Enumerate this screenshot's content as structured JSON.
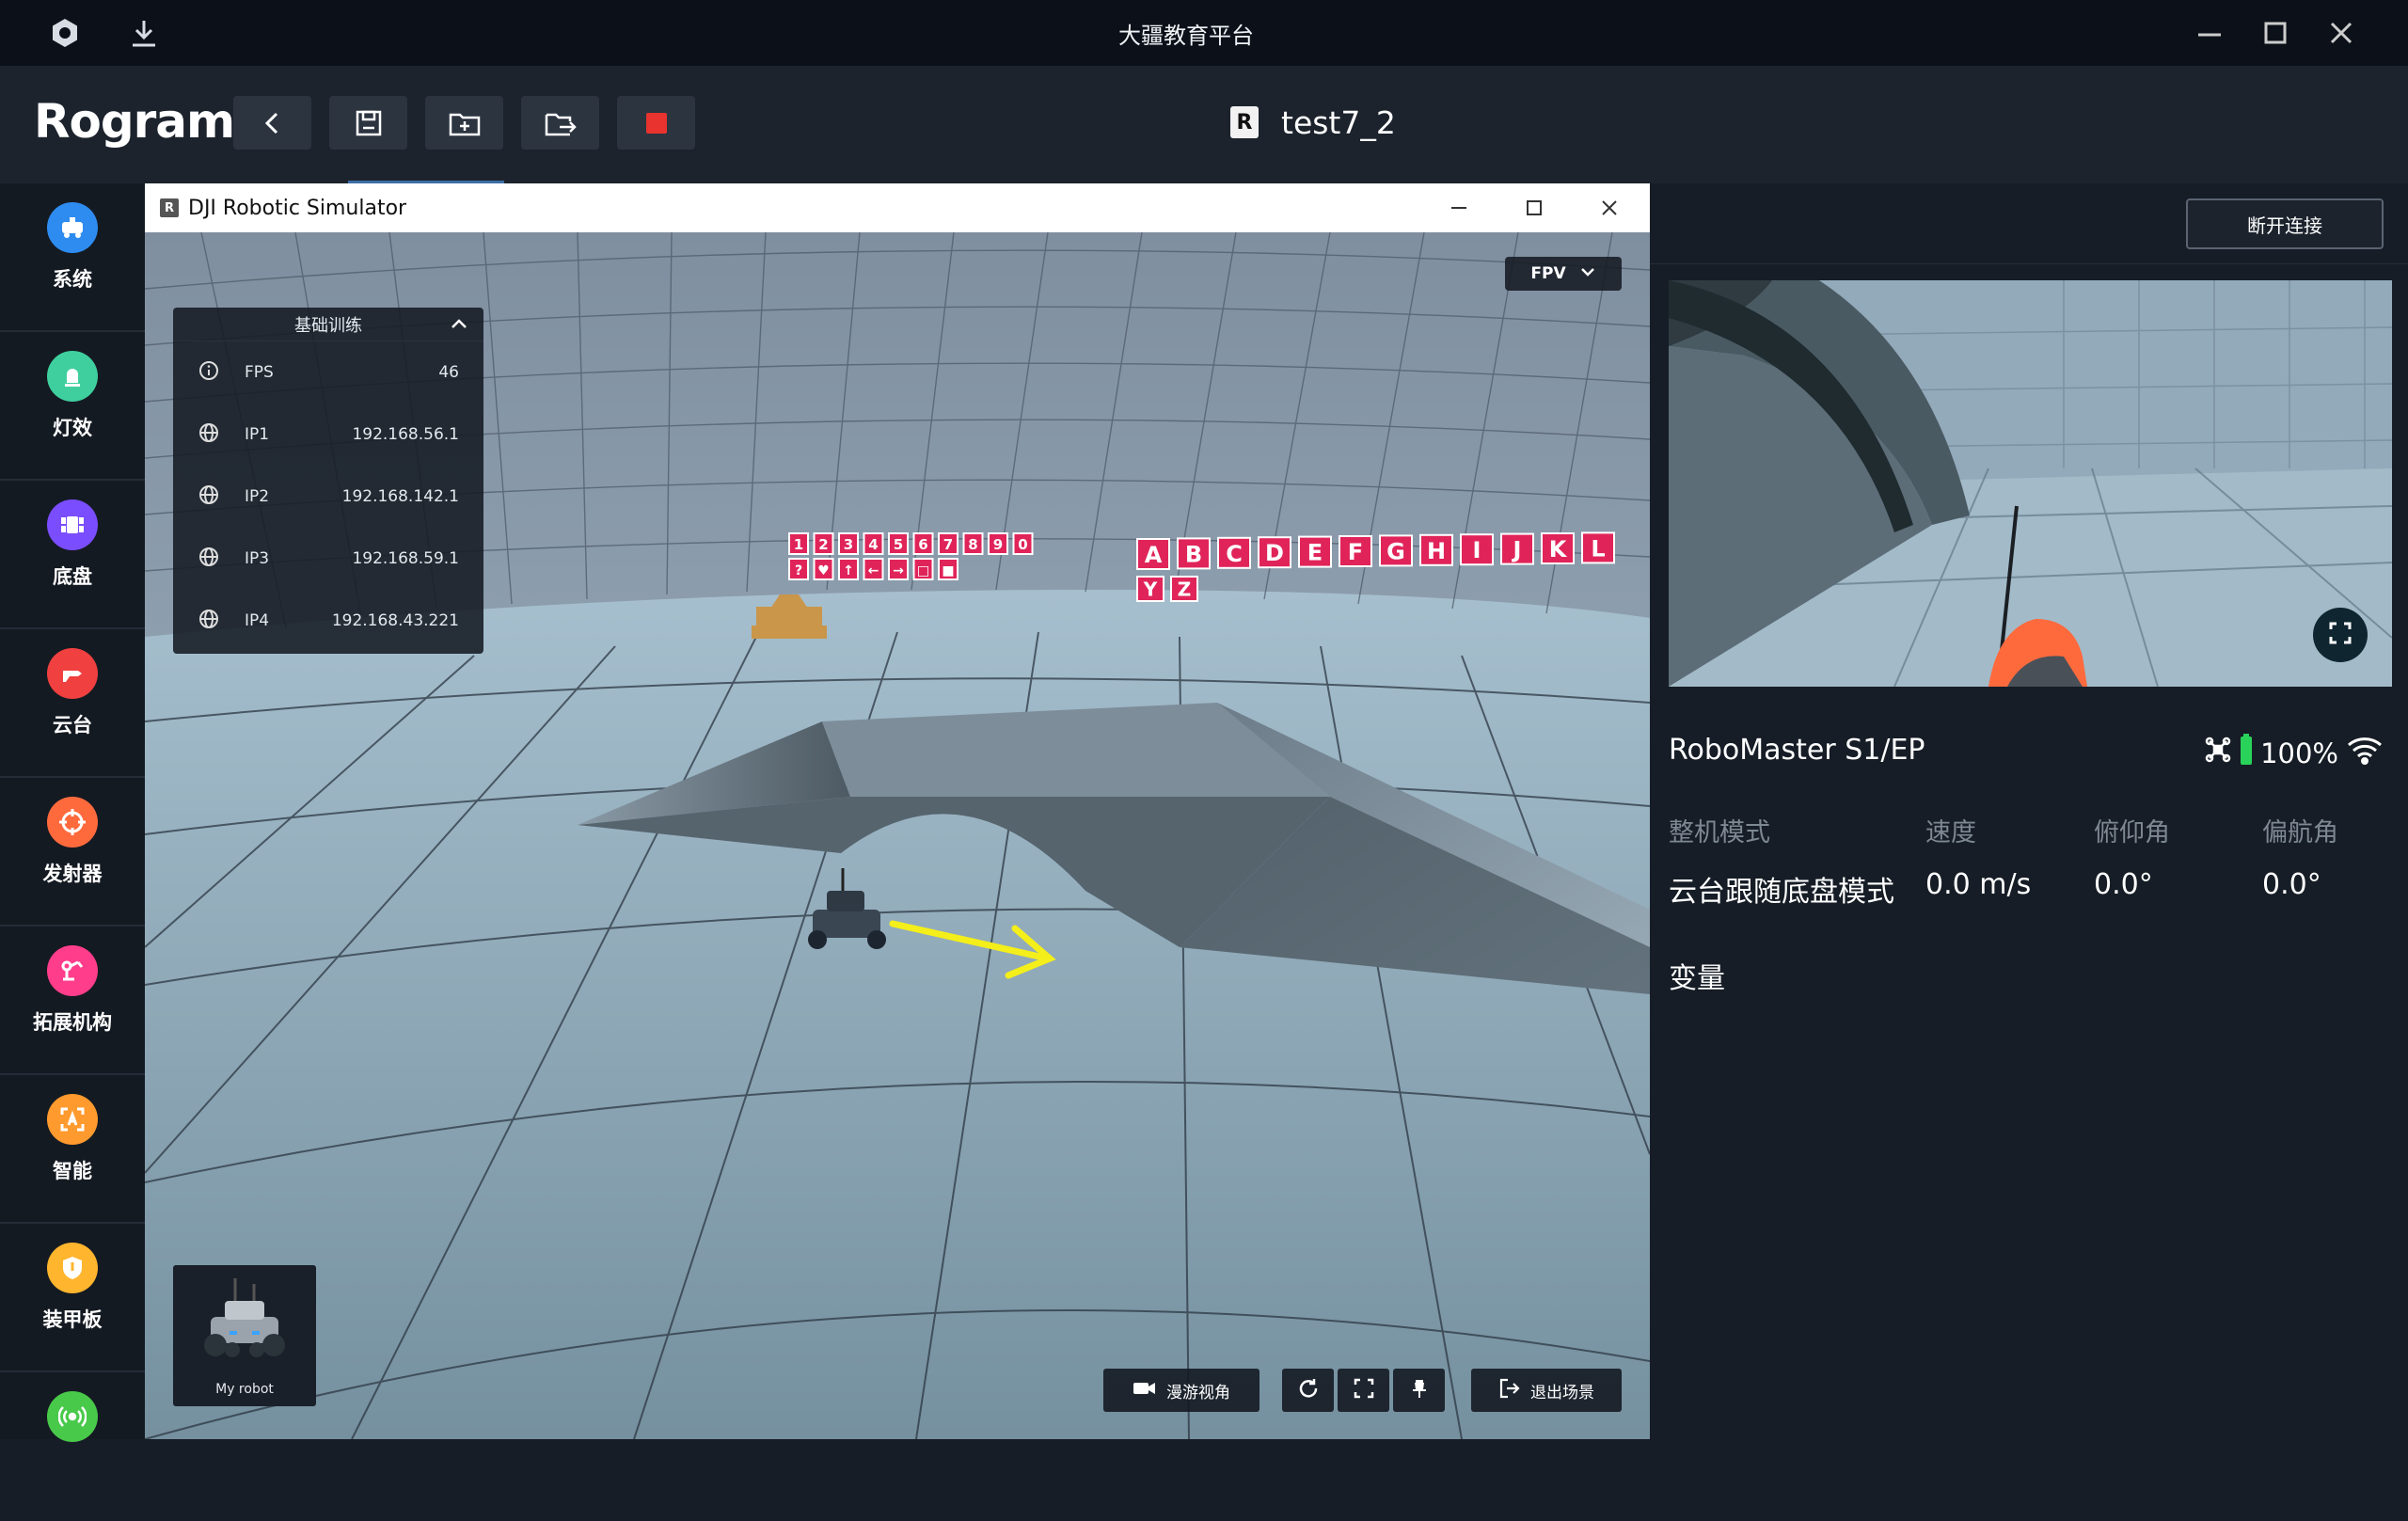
{
  "window": {
    "title": "大疆教育平台"
  },
  "app": {
    "brand": "Rogram"
  },
  "project": {
    "logo": "R",
    "name": "test7_2"
  },
  "sidebar": {
    "items": [
      {
        "label": "系统",
        "color": "#2e8cf0",
        "icon": "robot-icon"
      },
      {
        "label": "灯效",
        "color": "#3fcf9f",
        "icon": "light-icon"
      },
      {
        "label": "底盘",
        "color": "#7a4dff",
        "icon": "chassis-icon"
      },
      {
        "label": "云台",
        "color": "#f04040",
        "icon": "gimbal-icon"
      },
      {
        "label": "发射器",
        "color": "#ff6a3d",
        "icon": "crosshair-icon"
      },
      {
        "label": "拓展机构",
        "color": "#ff3d8b",
        "icon": "arm-icon"
      },
      {
        "label": "智能",
        "color": "#ff9a2e",
        "icon": "ai-icon"
      },
      {
        "label": "装甲板",
        "color": "#ffb52e",
        "icon": "armor-icon"
      },
      {
        "label": "",
        "color": "#49c94a",
        "icon": "sensor-icon"
      }
    ]
  },
  "sim": {
    "title": "DJI Robotic Simulator",
    "logo": "R",
    "panel_title": "基础训练",
    "rows": [
      {
        "label": "FPS",
        "value": "46"
      },
      {
        "label": "IP1",
        "value": "192.168.56.1"
      },
      {
        "label": "IP2",
        "value": "192.168.142.1"
      },
      {
        "label": "IP3",
        "value": "192.168.59.1"
      },
      {
        "label": "IP4",
        "value": "192.168.43.221"
      }
    ],
    "view_mode": "FPV",
    "robot_label": "My robot",
    "roam_label": "漫游视角",
    "exit_label": "退出场景",
    "signs_row1": [
      "1",
      "2",
      "3",
      "4",
      "5",
      "6",
      "7",
      "8",
      "9",
      "0"
    ],
    "signs_row2": [
      "?",
      "♥",
      "↑",
      "←",
      "→",
      "□",
      "■"
    ],
    "letters_row1": [
      "A",
      "B",
      "C",
      "D",
      "E",
      "F",
      "G",
      "H",
      "I",
      "J",
      "K",
      "L"
    ],
    "letters_row2": [
      "Y",
      "Z"
    ]
  },
  "right": {
    "disconnect_label": "断开连接",
    "robot_name": "RoboMaster S1/EP",
    "battery": "100%",
    "stats": [
      {
        "label": "整机模式",
        "value": "云台跟随底盘模式"
      },
      {
        "label": "速度",
        "value": "0.0 m/s"
      },
      {
        "label": "俯仰角",
        "value": "0.0°"
      },
      {
        "label": "偏航角",
        "value": "0.0°"
      }
    ],
    "variables_label": "变量"
  },
  "colors": {
    "accent_stop": "#e8332f",
    "tab_underline": "#3d6ea8",
    "battery": "#29d35a",
    "arrow": "#f4ee1a"
  }
}
